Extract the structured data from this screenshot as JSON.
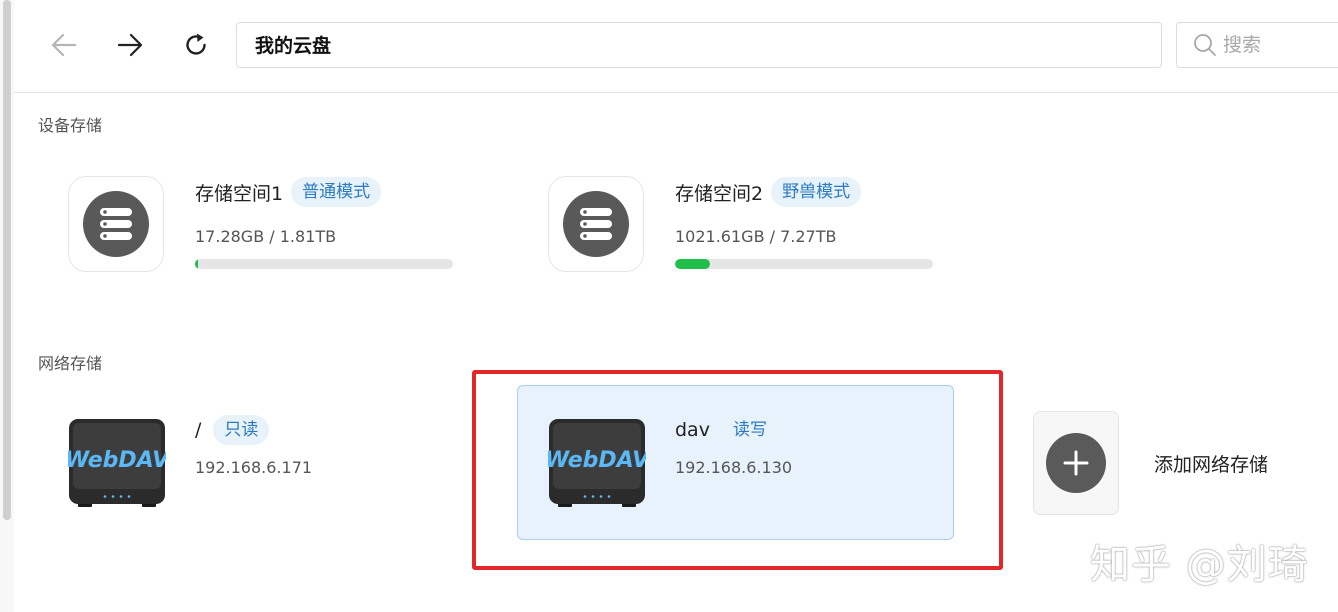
{
  "toolbar": {
    "back_icon": "arrow-left-icon",
    "forward_icon": "arrow-right-icon",
    "refresh_icon": "refresh-icon",
    "path": "我的云盘",
    "search_placeholder": "搜索"
  },
  "device_storage": {
    "title": "设备存储",
    "items": [
      {
        "name": "存储空间1",
        "mode": "普通模式",
        "usage": "17.28GB / 1.81TB",
        "fraction": 0.0093,
        "icon": "server-disk-icon"
      },
      {
        "name": "存储空间2",
        "mode": "野兽模式",
        "usage": "1021.61GB / 7.27TB",
        "fraction": 0.137,
        "icon": "server-disk-icon"
      }
    ]
  },
  "network_storage": {
    "title": "网络存储",
    "items": [
      {
        "name": "/",
        "access": "只读",
        "ip": "192.168.6.171",
        "logo_text": "WebDAV"
      },
      {
        "name": "dav",
        "access": "读写",
        "ip": "192.168.6.130",
        "logo_text": "WebDAV"
      }
    ],
    "add_label": "添加网络存储",
    "add_icon": "plus-icon"
  },
  "watermark": "知乎 @刘琦",
  "colors": {
    "progress": "#1fbf4a",
    "tag_bg": "#e7f2fb",
    "tag_text": "#2b7bc2",
    "highlight_frame": "#e3262a",
    "selected_bg": "#e8f2fd"
  }
}
